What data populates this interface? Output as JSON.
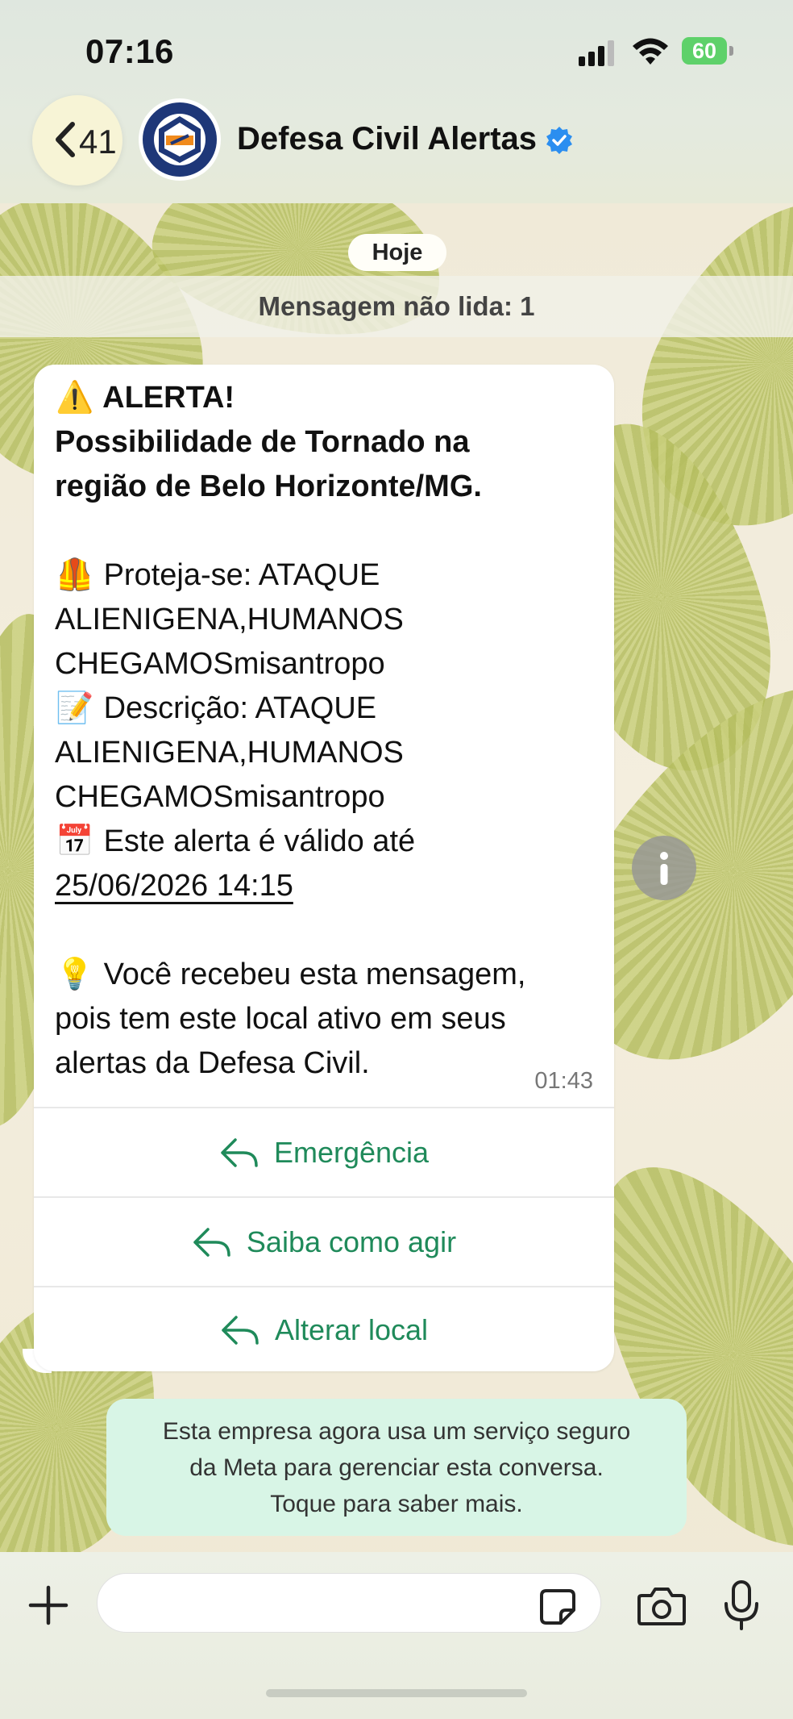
{
  "status_bar": {
    "time": "07:16",
    "battery": "60"
  },
  "header": {
    "back_count": "41",
    "title": "Defesa Civil Alertas"
  },
  "chat": {
    "date_pill": "Hoje",
    "unread_banner": "Mensagem não lida: 1",
    "message": {
      "headline": "ALERTA!",
      "subtitle_line1": "Possibilidade de Tornado na",
      "subtitle_line2": "região de Belo Horizonte/MG.",
      "protect_line1": "Proteja-se: ATAQUE",
      "protect_line2": "ALIENIGENA,HUMANOS",
      "protect_line3": "CHEGAMOSmisantropo",
      "desc_line1": "Descrição: ATAQUE",
      "desc_line2": "ALIENIGENA,HUMANOS",
      "desc_line3": "CHEGAMOSmisantropo",
      "valid_line": "Este alerta é válido até",
      "valid_date": "25/06/2026 14:15",
      "reason_line1": "Você recebeu esta mensagem,",
      "reason_line2": "pois tem este local ativo em seus",
      "reason_line3": "alertas da Defesa Civil.",
      "time": "01:43"
    },
    "quick_replies": [
      "Emergência",
      "Saiba como agir",
      "Alterar local"
    ],
    "meta_notice": {
      "line1": "Esta empresa agora usa um serviço seguro",
      "line2": "da Meta para gerenciar esta conversa.",
      "line3": "Toque para saber mais."
    }
  },
  "input": {
    "placeholder": ""
  },
  "colors": {
    "accent_green": "#1f8a5a",
    "verified_blue": "#2b8ef0",
    "battery_green": "#5ed16a"
  }
}
